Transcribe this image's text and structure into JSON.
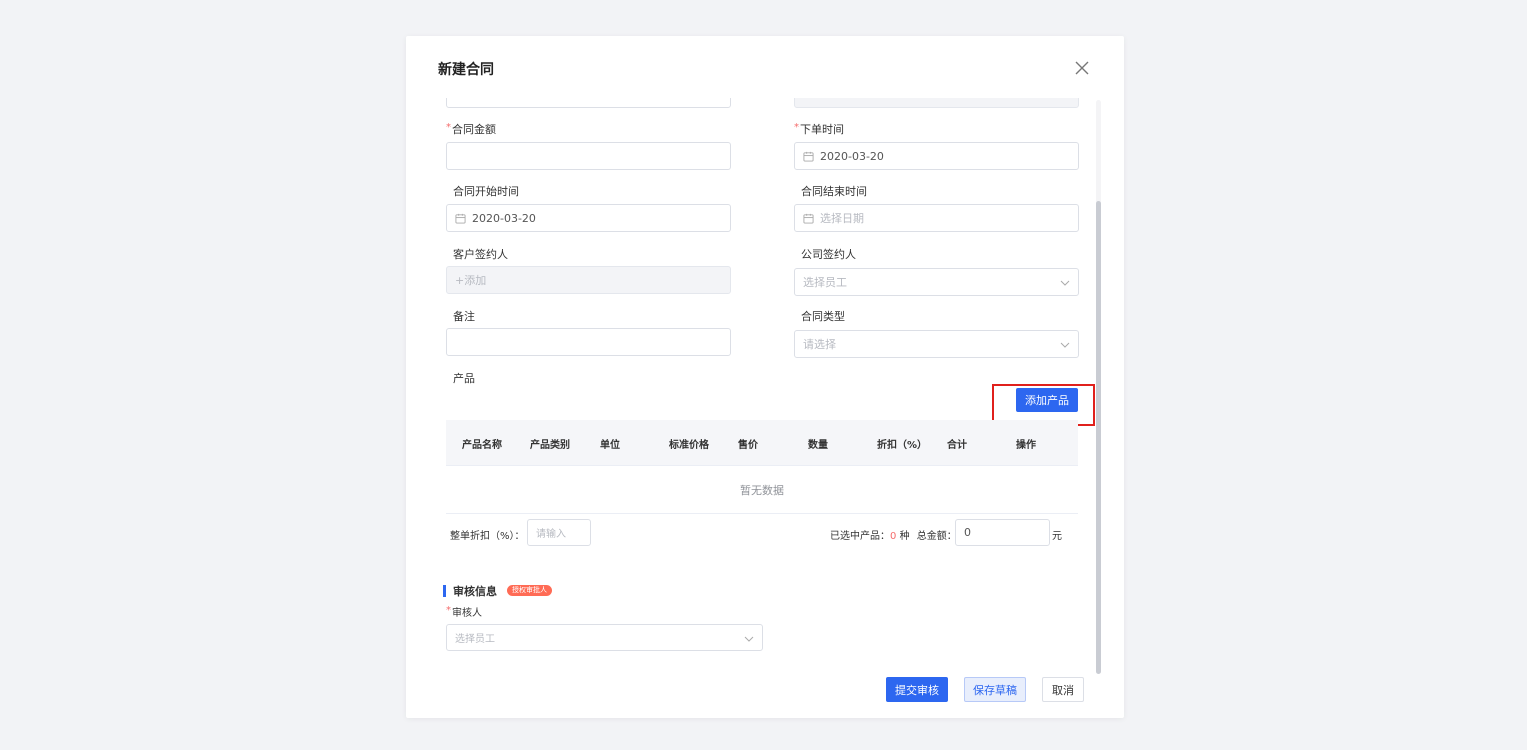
{
  "dialog": {
    "title": "新建合同",
    "close_icon": "close-icon"
  },
  "form": {
    "contract_amount": {
      "label": "合同金额",
      "required": "*",
      "value": ""
    },
    "order_time": {
      "label": "下单时间",
      "required": "*",
      "value": "2020-03-20"
    },
    "start_time": {
      "label": "合同开始时间",
      "value": "2020-03-20"
    },
    "end_time": {
      "label": "合同结束时间",
      "placeholder": "选择日期"
    },
    "customer_signer": {
      "label": "客户签约人",
      "placeholder": "+添加"
    },
    "company_signer": {
      "label": "公司签约人",
      "placeholder": "选择员工"
    },
    "remark": {
      "label": "备注",
      "value": ""
    },
    "contract_type": {
      "label": "合同类型",
      "placeholder": "请选择"
    },
    "product": {
      "label": "产品",
      "add_button": "添加产品"
    }
  },
  "table": {
    "columns": [
      "产品名称",
      "产品类别",
      "单位",
      "标准价格",
      "售价",
      "数量",
      "折扣（%）",
      "合计",
      "操作"
    ],
    "empty_text": "暂无数据"
  },
  "summary": {
    "discount_label": "整单折扣（%）：",
    "discount_placeholder": "请输入",
    "selected_label": "已选中产品：",
    "selected_count": "0",
    "selected_unit": "种",
    "total_label": "总金额：",
    "total_value": "0",
    "currency": "元"
  },
  "review": {
    "title": "审核信息",
    "badge": "授权审批人",
    "reviewer_label": "审核人",
    "required": "*",
    "reviewer_placeholder": "选择员工"
  },
  "footer": {
    "submit": "提交审核",
    "save_draft": "保存草稿",
    "cancel": "取消"
  },
  "colors": {
    "primary": "#2d67f0",
    "required": "#f56c6c",
    "highlight": "#e0201c",
    "badge": "#ff6b55"
  }
}
